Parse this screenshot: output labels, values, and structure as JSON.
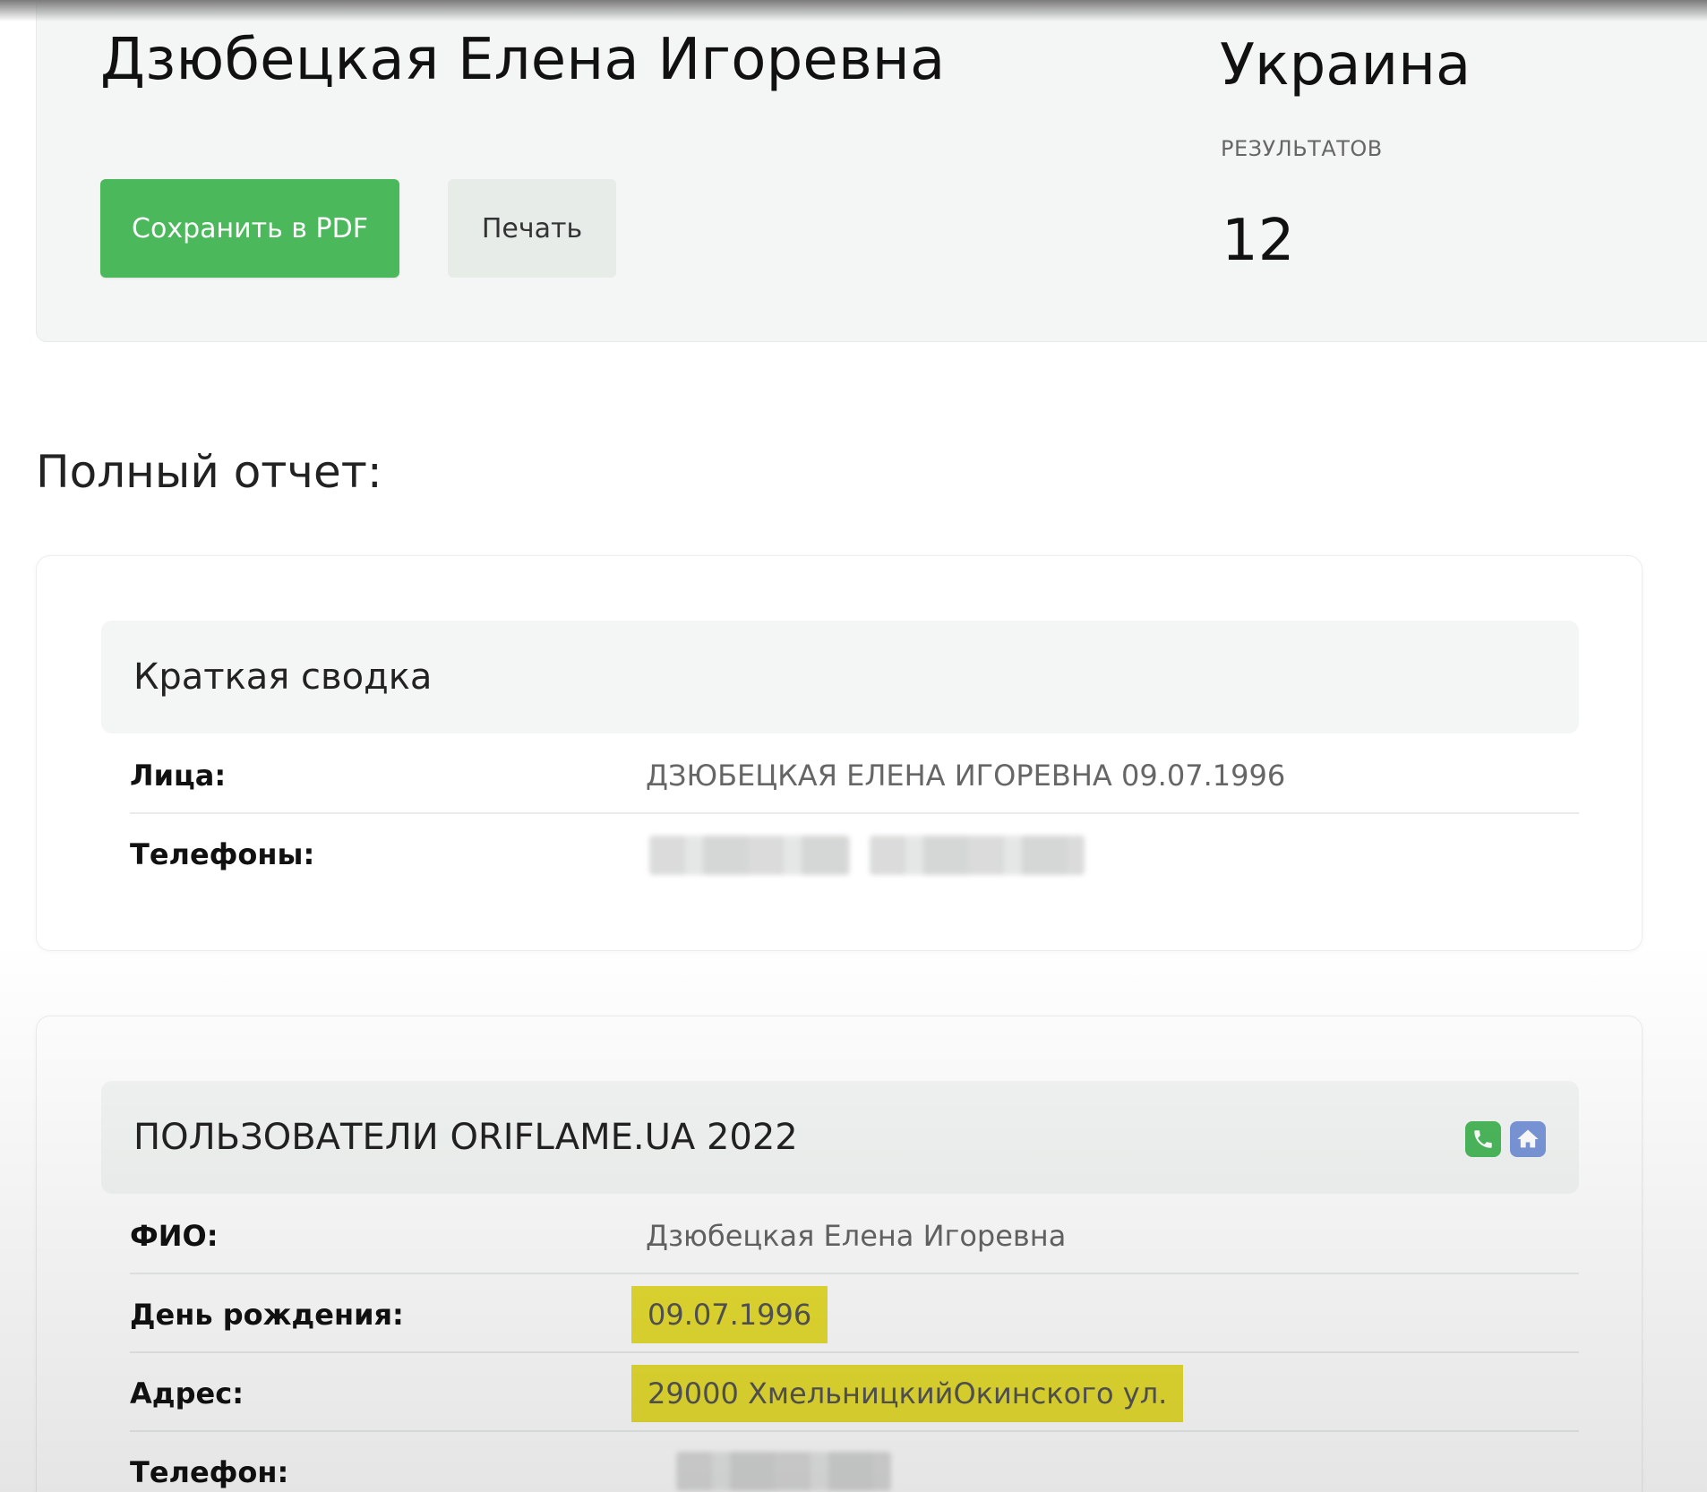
{
  "header": {
    "name": "Дзюбецкая Елена Игоревна",
    "save_pdf_label": "Сохранить в PDF",
    "print_label": "Печать",
    "country": "Украина",
    "results_label": "РЕЗУЛЬТАТОВ",
    "results_count": "12"
  },
  "report": {
    "title": "Полный отчет:",
    "summary": {
      "heading": "Краткая сводка",
      "rows": [
        {
          "label": "Лица:",
          "value": "ДЗЮБЕЦКАЯ ЕЛЕНА ИГОРЕВНА 09.07.1996"
        },
        {
          "label": "Телефоны:",
          "value": ""
        }
      ]
    },
    "oriflame": {
      "heading": "ПОЛЬЗОВАТЕЛИ ORIFLAME.UA 2022",
      "icons": [
        "phone-icon",
        "home-icon"
      ],
      "rows": [
        {
          "label": "ФИО:",
          "value": "Дзюбецкая Елена Игоревна"
        },
        {
          "label": "День рождения:",
          "value": "09.07.1996"
        },
        {
          "label": "Адрес:",
          "value": "29000 ХмельницкийОкинского ул."
        },
        {
          "label": "Телефон:",
          "value": ""
        }
      ]
    }
  },
  "colors": {
    "accent_green": "#4cb85c",
    "highlight_yellow": "#e7de31",
    "home_blue": "#7b97d9"
  }
}
